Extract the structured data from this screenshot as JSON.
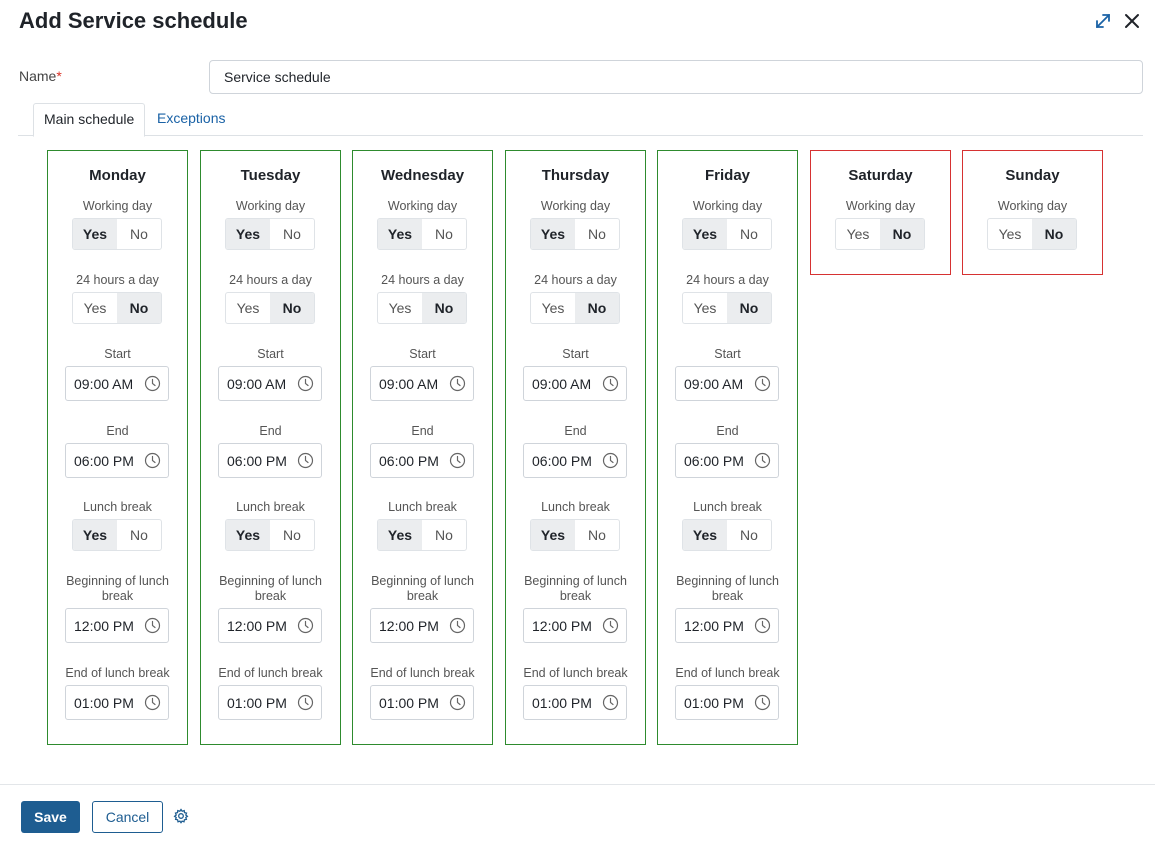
{
  "dialog": {
    "title": "Add Service schedule"
  },
  "icons": {
    "expand": "expand-icon",
    "close": "close-icon",
    "clock": "clock-icon",
    "settings": "gear-icon"
  },
  "colors": {
    "working_border": "#2e8b2e",
    "nonworking_border": "#d63232",
    "primary": "#1e5d91",
    "link": "#1a62a6",
    "required": "#d93025"
  },
  "name_field": {
    "label": "Name",
    "required_mark": "*",
    "value": "Service schedule"
  },
  "tabs": [
    {
      "label": "Main schedule",
      "active": true
    },
    {
      "label": "Exceptions",
      "active": false
    }
  ],
  "field_labels": {
    "working_day": "Working day",
    "hours24": "24 hours a day",
    "start": "Start",
    "end": "End",
    "lunch_break": "Lunch break",
    "lunch_start": "Beginning of lunch break",
    "lunch_end": "End of lunch break",
    "yes": "Yes",
    "no": "No"
  },
  "days": [
    {
      "name": "Monday",
      "working_day": "Yes",
      "hours24": "No",
      "start": "09:00 AM",
      "end": "06:00 PM",
      "lunch_break": "Yes",
      "lunch_start": "12:00 PM",
      "lunch_end": "01:00 PM"
    },
    {
      "name": "Tuesday",
      "working_day": "Yes",
      "hours24": "No",
      "start": "09:00 AM",
      "end": "06:00 PM",
      "lunch_break": "Yes",
      "lunch_start": "12:00 PM",
      "lunch_end": "01:00 PM"
    },
    {
      "name": "Wednesday",
      "working_day": "Yes",
      "hours24": "No",
      "start": "09:00 AM",
      "end": "06:00 PM",
      "lunch_break": "Yes",
      "lunch_start": "12:00 PM",
      "lunch_end": "01:00 PM"
    },
    {
      "name": "Thursday",
      "working_day": "Yes",
      "hours24": "No",
      "start": "09:00 AM",
      "end": "06:00 PM",
      "lunch_break": "Yes",
      "lunch_start": "12:00 PM",
      "lunch_end": "01:00 PM"
    },
    {
      "name": "Friday",
      "working_day": "Yes",
      "hours24": "No",
      "start": "09:00 AM",
      "end": "06:00 PM",
      "lunch_break": "Yes",
      "lunch_start": "12:00 PM",
      "lunch_end": "01:00 PM"
    },
    {
      "name": "Saturday",
      "working_day": "No"
    },
    {
      "name": "Sunday",
      "working_day": "No"
    }
  ],
  "footer": {
    "save_label": "Save",
    "cancel_label": "Cancel"
  }
}
